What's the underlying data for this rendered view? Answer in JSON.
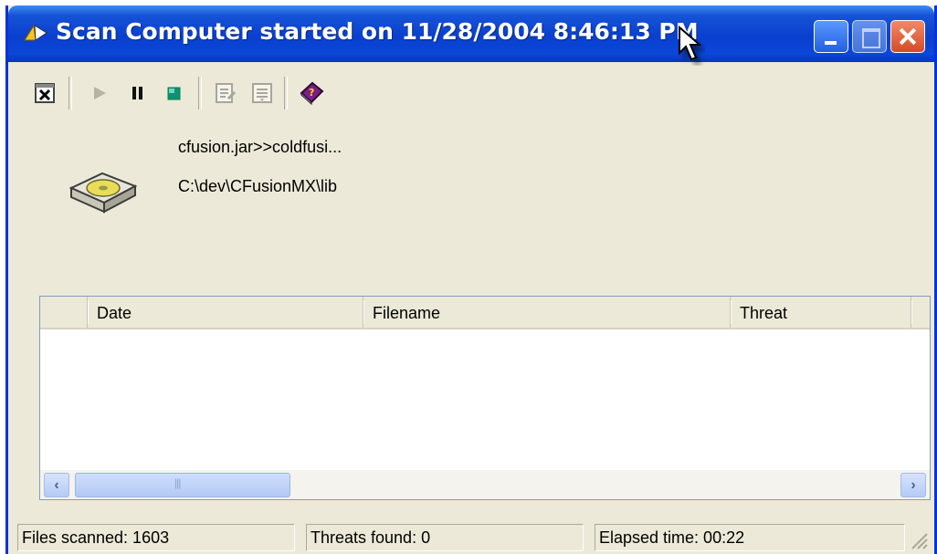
{
  "window": {
    "title": "Scan Computer started on 11/28/2004 8:46:13 PM",
    "title_gradient": [
      "#3a8cf3",
      "#0a3fcf"
    ],
    "border_color": "#0831d9"
  },
  "caption_buttons": [
    "minimize-icon",
    "maximize-icon",
    "close-icon"
  ],
  "toolbar": {
    "buttons": [
      {
        "name": "close-scan-icon",
        "enabled": true
      },
      {
        "name": "play-icon",
        "enabled": false
      },
      {
        "name": "pause-icon",
        "enabled": true
      },
      {
        "name": "stop-icon",
        "enabled": true
      },
      {
        "name": "properties-icon",
        "enabled": false
      },
      {
        "name": "details-icon",
        "enabled": false
      },
      {
        "name": "help-book-icon",
        "enabled": true
      }
    ]
  },
  "scan": {
    "current_file": "cfusion.jar>>coldfusi...",
    "current_path": "C:\\dev\\CFusionMX\\lib"
  },
  "results_table": {
    "columns": [
      "",
      "Date",
      "Filename",
      "Threat",
      ""
    ],
    "rows": []
  },
  "statusbar": {
    "files_scanned": "Files scanned: 1603",
    "threats_found": "Threats found: 0",
    "elapsed_time": "Elapsed time: 00:22"
  },
  "colors": {
    "face": "#ece9d8",
    "list_border": "#7f9db9",
    "scroll_thumb": "#b3c9f4"
  }
}
